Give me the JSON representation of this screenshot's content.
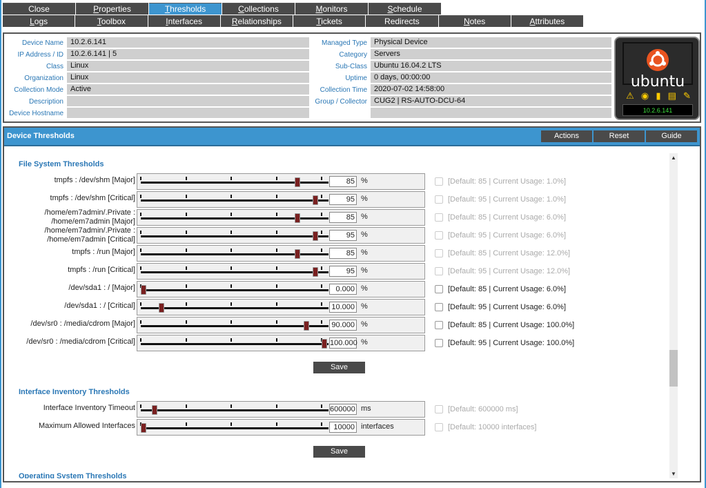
{
  "tabs_row1": [
    {
      "label": "Close",
      "u": "",
      "rest": "Close",
      "active": false
    },
    {
      "label": "Properties",
      "u": "P",
      "rest": "roperties",
      "active": false
    },
    {
      "label": "Thresholds",
      "u": "T",
      "rest": "hresholds",
      "active": true
    },
    {
      "label": "Collections",
      "u": "C",
      "rest": "ollections",
      "active": false
    },
    {
      "label": "Monitors",
      "u": "M",
      "rest": "onitors",
      "active": false
    },
    {
      "label": "Schedule",
      "u": "S",
      "rest": "chedule",
      "active": false
    }
  ],
  "tabs_row2": [
    {
      "label": "Logs",
      "u": "L",
      "rest": "ogs"
    },
    {
      "label": "Toolbox",
      "u": "T",
      "rest": "oolbox"
    },
    {
      "label": "Interfaces",
      "u": "I",
      "rest": "nterfaces"
    },
    {
      "label": "Relationships",
      "u": "R",
      "rest": "elationships"
    },
    {
      "label": "Tickets",
      "u": "T",
      "rest": "ickets"
    },
    {
      "label": "Redirects",
      "u": "",
      "rest": "Redirects"
    },
    {
      "label": "Notes",
      "u": "N",
      "rest": "otes"
    },
    {
      "label": "Attributes",
      "u": "A",
      "rest": "ttributes"
    }
  ],
  "info_left": [
    {
      "label": "Device Name",
      "value": "10.2.6.141"
    },
    {
      "label": "IP Address / ID",
      "value": "10.2.6.141 | 5"
    },
    {
      "label": "Class",
      "value": "Linux"
    },
    {
      "label": "Organization",
      "value": "Linux"
    },
    {
      "label": "Collection Mode",
      "value": "Active"
    },
    {
      "label": "Description",
      "value": ""
    },
    {
      "label": "Device Hostname",
      "value": ""
    }
  ],
  "info_right": [
    {
      "label": "Managed Type",
      "value": "Physical Device"
    },
    {
      "label": "Category",
      "value": "Servers"
    },
    {
      "label": "Sub-Class",
      "value": "Ubuntu 16.04.2 LTS"
    },
    {
      "label": "Uptime",
      "value": "0 days, 00:00:00"
    },
    {
      "label": "Collection Time",
      "value": "2020-07-02 14:58:00"
    },
    {
      "label": "Group / Collector",
      "value": "CUG2 | RS-AUTO-DCU-64"
    }
  ],
  "logo": {
    "word": "ubuntu",
    "ip": "10.2.6.141",
    "status_icons": [
      "warning-icon",
      "lifebuoy-icon",
      "chart-icon",
      "printer-icon",
      "wrench-icon"
    ],
    "brand_color": "#e95420"
  },
  "panel": {
    "title": "Device Thresholds",
    "actions": "Actions",
    "reset": "Reset",
    "guide": "Guide"
  },
  "fs": {
    "title": "File System Thresholds",
    "save": "Save"
  },
  "fs_rows": [
    {
      "label": "tmpfs : /dev/shm [Major]",
      "value": "85",
      "unit": "%",
      "level": 0.85,
      "enabled": false,
      "default": "[Default: 85 | Current Usage: 1.0%]"
    },
    {
      "label": "tmpfs : /dev/shm [Critical]",
      "value": "95",
      "unit": "%",
      "level": 0.95,
      "enabled": false,
      "default": "[Default: 95 | Current Usage: 1.0%]"
    },
    {
      "label": "/home/em7admin/.Private : /home/em7admin [Major]",
      "value": "85",
      "unit": "%",
      "level": 0.85,
      "enabled": false,
      "default": "[Default: 85 | Current Usage: 6.0%]"
    },
    {
      "label": "/home/em7admin/.Private : /home/em7admin [Critical]",
      "value": "95",
      "unit": "%",
      "level": 0.95,
      "enabled": false,
      "default": "[Default: 95 | Current Usage: 6.0%]"
    },
    {
      "label": "tmpfs : /run [Major]",
      "value": "85",
      "unit": "%",
      "level": 0.85,
      "enabled": false,
      "default": "[Default: 85 | Current Usage: 12.0%]"
    },
    {
      "label": "tmpfs : /run [Critical]",
      "value": "95",
      "unit": "%",
      "level": 0.95,
      "enabled": false,
      "default": "[Default: 95 | Current Usage: 12.0%]"
    },
    {
      "label": "/dev/sda1 : / [Major]",
      "value": "0.000",
      "unit": "%",
      "level": 0.0,
      "enabled": true,
      "default": "[Default: 85 | Current Usage: 6.0%]"
    },
    {
      "label": "/dev/sda1 : / [Critical]",
      "value": "10.000",
      "unit": "%",
      "level": 0.1,
      "enabled": true,
      "default": "[Default: 95 | Current Usage: 6.0%]"
    },
    {
      "label": "/dev/sr0 : /media/cdrom [Major]",
      "value": "90.000",
      "unit": "%",
      "level": 0.9,
      "enabled": true,
      "default": "[Default: 85 | Current Usage: 100.0%]"
    },
    {
      "label": "/dev/sr0 : /media/cdrom [Critical]",
      "value": "100.000",
      "unit": "%",
      "level": 1.0,
      "enabled": true,
      "default": "[Default: 95 | Current Usage: 100.0%]"
    }
  ],
  "inv": {
    "title": "Interface Inventory Thresholds",
    "save": "Save"
  },
  "inv_rows": [
    {
      "label": "Interface Inventory Timeout",
      "value": "600000",
      "unit": "ms",
      "level": 0.06,
      "enabled": false,
      "default": "[Default: 600000 ms]"
    },
    {
      "label": "Maximum Allowed Interfaces",
      "value": "10000",
      "unit": "interfaces",
      "level": 0.0,
      "enabled": false,
      "default": "[Default: 10000 interfaces]"
    }
  ],
  "os": {
    "title": "Operating System Thresholds"
  }
}
